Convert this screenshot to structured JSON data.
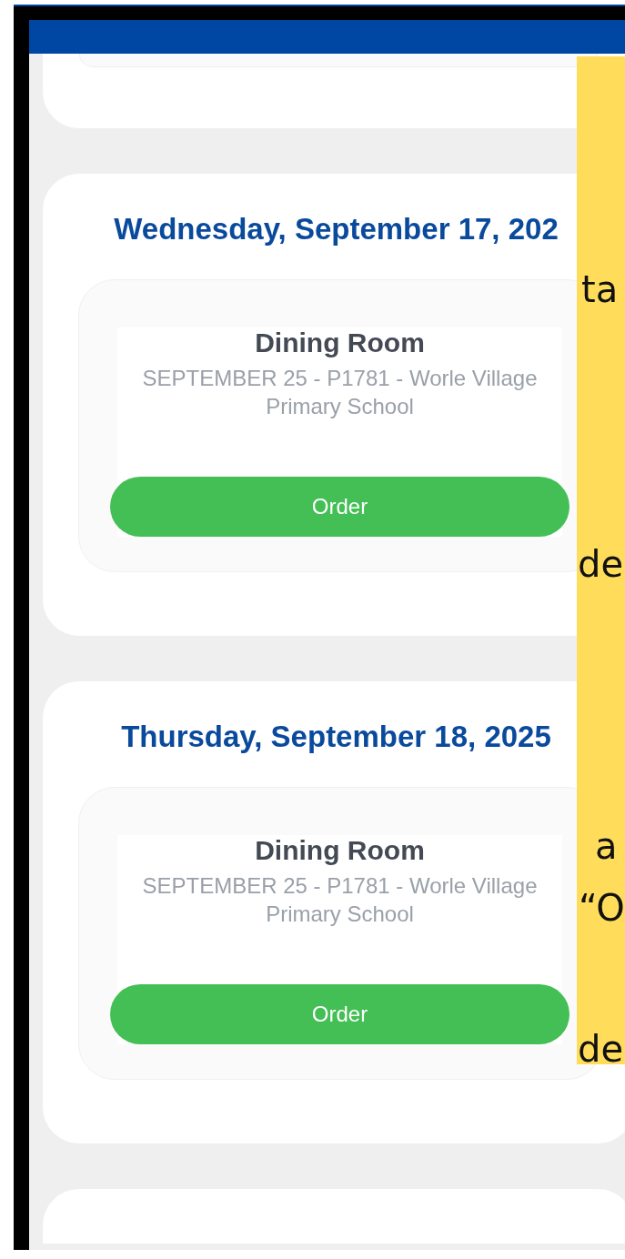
{
  "days": [
    {
      "date": "Wednesday, September 17, 202",
      "items": [
        {
          "title": "Dining Room",
          "subtitle": "SEPTEMBER 25 - P1781 - Worle Village Primary School",
          "button": "Order"
        }
      ]
    },
    {
      "date": "Thursday, September 18, 2025",
      "items": [
        {
          "title": "Dining Room",
          "subtitle": "SEPTEMBER 25 - P1781 - Worle Village Primary School",
          "button": "Order"
        }
      ]
    }
  ],
  "overlay": {
    "lines": [
      "ta",
      "de",
      "a",
      "“O",
      "de"
    ]
  }
}
